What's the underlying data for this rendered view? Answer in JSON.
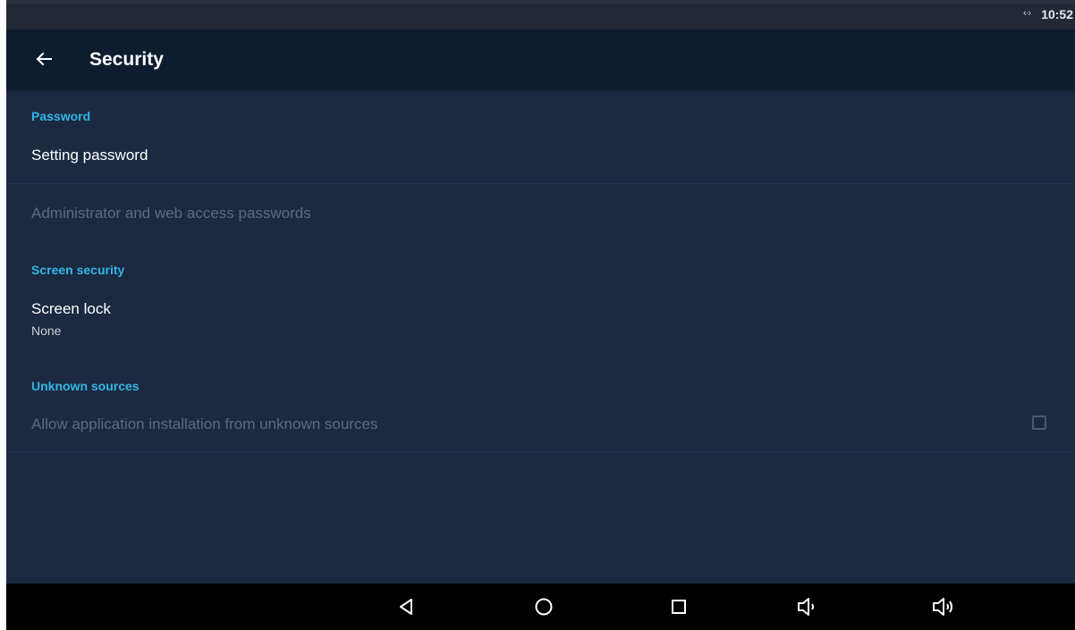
{
  "status_bar": {
    "network_icon": "data-transfer-icon",
    "time": "10:52"
  },
  "app_bar": {
    "back_icon": "arrow-back-icon",
    "title": "Security"
  },
  "sections": {
    "password": {
      "header": "Password",
      "setting_password": "Setting password",
      "admin_passwords": "Administrator and web access passwords"
    },
    "screen_security": {
      "header": "Screen security",
      "screen_lock_title": "Screen lock",
      "screen_lock_summary": "None"
    },
    "unknown_sources": {
      "header": "Unknown sources",
      "allow_install_title": "Allow application installation from unknown sources",
      "allow_install_checked": false
    }
  },
  "nav_bar": {
    "back": "nav-back-icon",
    "home": "nav-home-icon",
    "recents": "nav-recents-icon",
    "volume_down": "volume-down-icon",
    "volume_up": "volume-up-icon"
  },
  "colors": {
    "accent": "#33b5e5",
    "background": "#1b2a41",
    "app_bar": "#0e1c30",
    "disabled_text": "#5d6b7d"
  }
}
